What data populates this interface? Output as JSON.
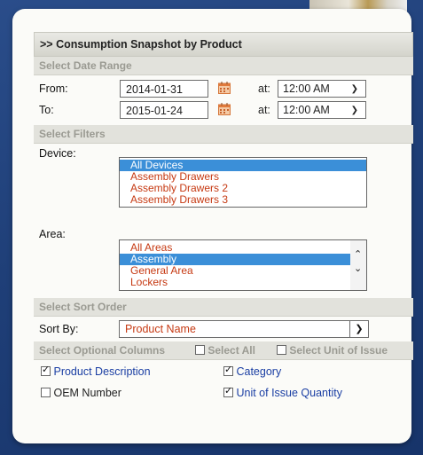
{
  "form": {
    "title": ">> Consumption Snapshot by Product",
    "date_section": "Select Date Range",
    "from_label": "From:",
    "from_date": "2014-01-31",
    "to_label": "To:",
    "to_date": "2015-01-24",
    "at_label": "at:",
    "from_time": "12:00 AM",
    "to_time": "12:00 AM",
    "filters_section": "Select Filters",
    "device_label": "Device:",
    "devices": [
      "All Devices",
      "Assembly Drawers",
      "Assembly Drawers 2",
      "Assembly Drawers 3"
    ],
    "device_selected": "All Devices",
    "area_label": "Area:",
    "areas": [
      "All Areas",
      "Assembly",
      "General Area",
      "Lockers"
    ],
    "area_selected": "Assembly",
    "sort_section": "Select Sort Order",
    "sort_label": "Sort By:",
    "sort_value": "Product Name",
    "columns_section": "Select Optional Columns",
    "select_all_label": "Select All",
    "select_unit_label": "Select Unit of Issue",
    "options": {
      "product_description": {
        "label": "Product Description",
        "checked": true
      },
      "category": {
        "label": "Category",
        "checked": true
      },
      "oem_number": {
        "label": "OEM Number",
        "checked": false
      },
      "unit_qty": {
        "label": "Unit of Issue Quantity",
        "checked": true
      }
    }
  },
  "colors": {
    "background": "#1f3f78",
    "list_text": "#c63a13",
    "selected_option": "#3b8fd8",
    "link_text": "#1a3ea3"
  }
}
